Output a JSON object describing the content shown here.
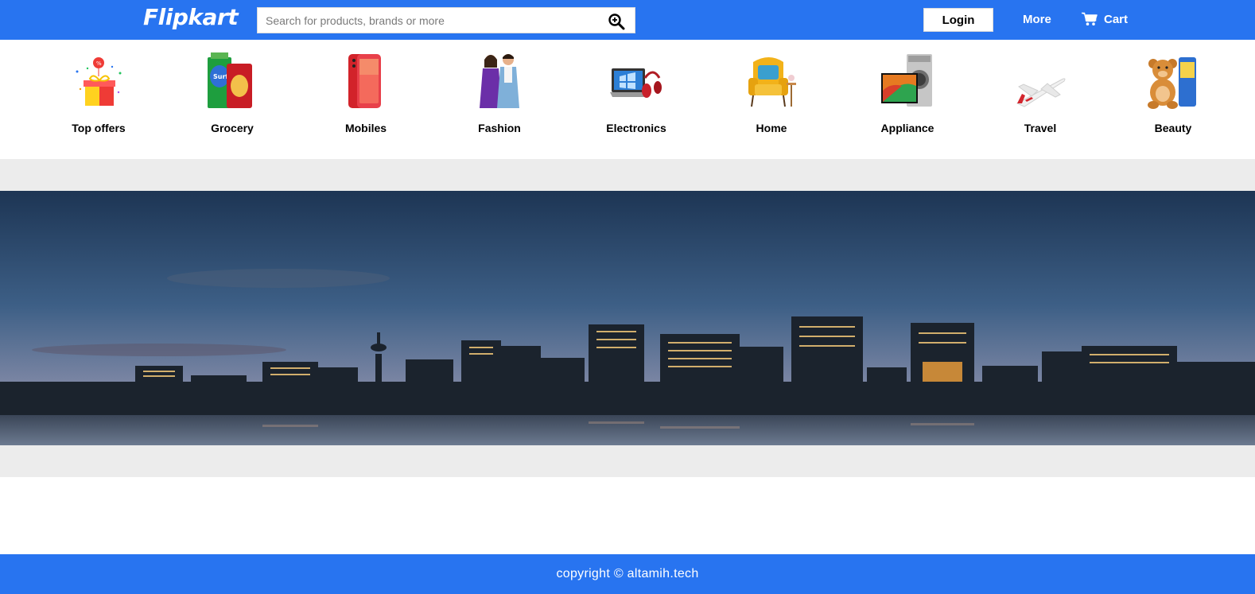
{
  "header": {
    "logo": "Flipkart",
    "search_placeholder": "Search for products, brands or more",
    "login_label": "Login",
    "more_label": "More",
    "cart_label": "Cart",
    "color": "#2874f0"
  },
  "categories": [
    {
      "label": "Top offers",
      "icon": "gift-box-icon"
    },
    {
      "label": "Grocery",
      "icon": "grocery-packs-icon"
    },
    {
      "label": "Mobiles",
      "icon": "smartphone-icon"
    },
    {
      "label": "Fashion",
      "icon": "fashion-couple-icon"
    },
    {
      "label": "Electronics",
      "icon": "laptop-headphones-icon"
    },
    {
      "label": "Home",
      "icon": "armchair-icon"
    },
    {
      "label": "Appliance",
      "icon": "tv-washer-icon"
    },
    {
      "label": "Travel",
      "icon": "airplane-icon"
    },
    {
      "label": "Beauty",
      "icon": "teddy-bear-icon"
    }
  ],
  "banner": {
    "image": "city-skyline-night-image"
  },
  "footer": {
    "text": "copyright © altamih.tech"
  }
}
